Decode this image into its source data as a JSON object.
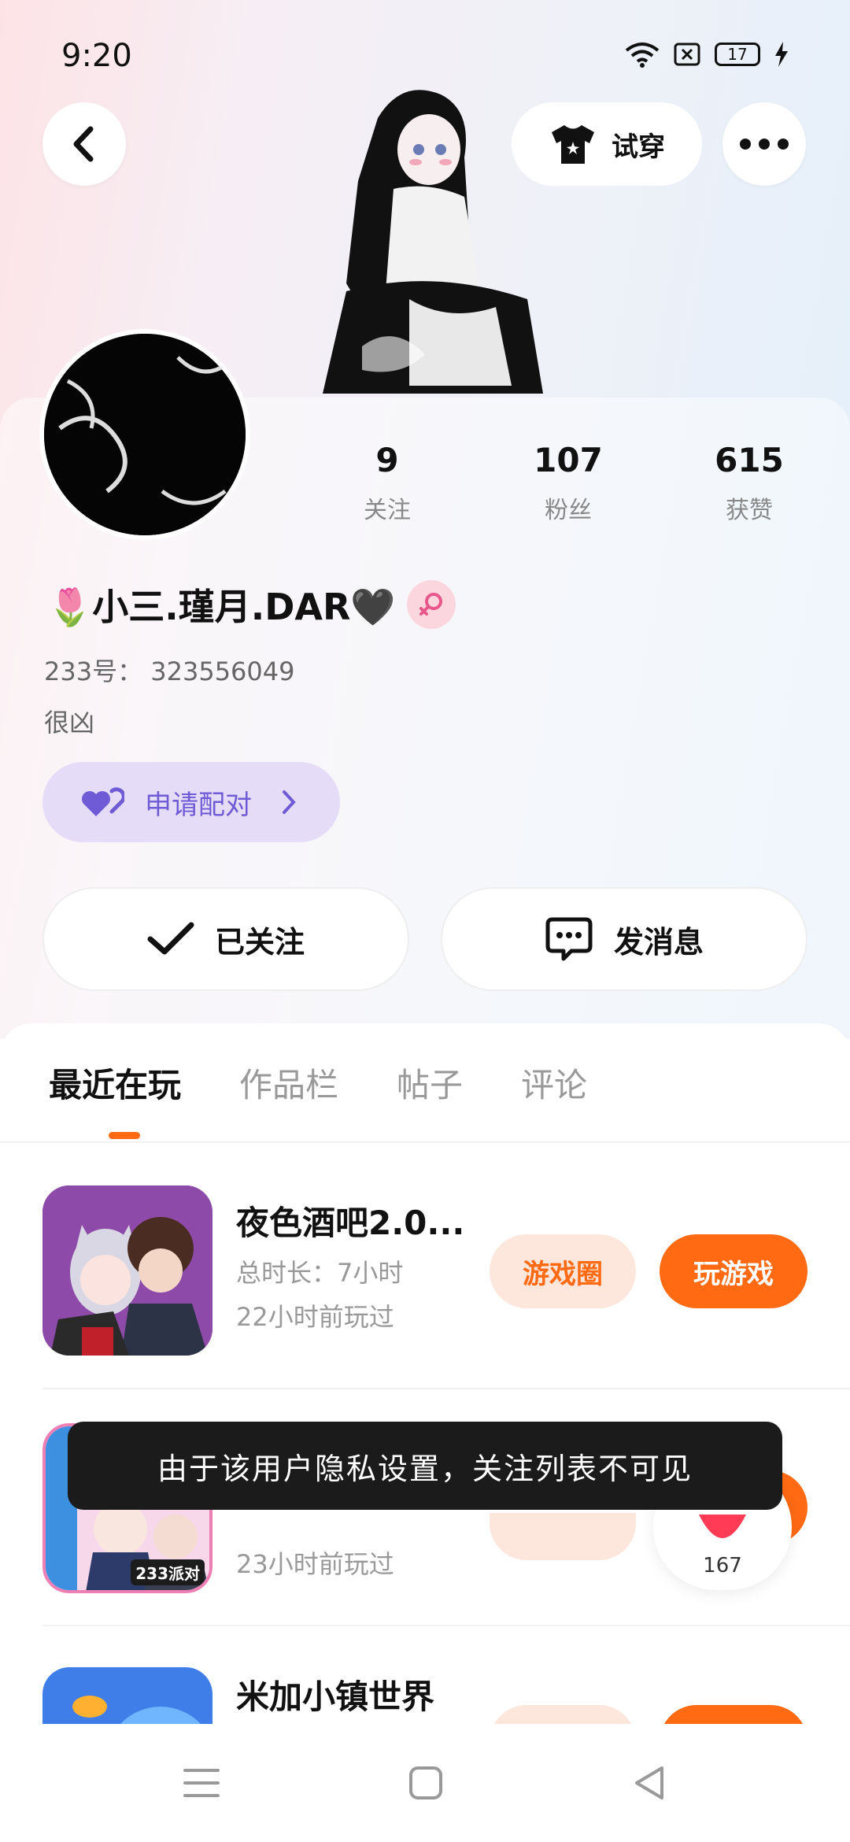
{
  "status_bar": {
    "time": "9:20",
    "battery": "17"
  },
  "header": {
    "back_icon": "chevron-left-icon",
    "tryon_label": "试穿",
    "more_icon": "more-dots-icon"
  },
  "profile": {
    "stats": [
      {
        "value": "9",
        "label": "关注"
      },
      {
        "value": "107",
        "label": "粉丝"
      },
      {
        "value": "615",
        "label": "获赞"
      }
    ],
    "nickname": "🌷小三.瑾月.DAR🖤",
    "uid": "233号： 323556049",
    "bio": "很凶",
    "pair_label": "申请配对",
    "followed_label": "已关注",
    "message_label": "发消息"
  },
  "tabs": [
    {
      "label": "最近在玩",
      "active": true
    },
    {
      "label": "作品栏",
      "active": false
    },
    {
      "label": "帖子",
      "active": false
    },
    {
      "label": "评论",
      "active": false
    }
  ],
  "games": [
    {
      "title": "夜色酒吧2.0...",
      "playtime": "总时长：7小时",
      "last_played": "22小时前玩过",
      "circle_label": "游戏圈",
      "play_label": "玩游戏"
    },
    {
      "title": "",
      "playtime": "",
      "last_played": "23小时前玩过",
      "circle_label": "",
      "play_label": "",
      "badge": "233派对"
    },
    {
      "title": "米加小镇世界",
      "playtime": "",
      "last_played": "",
      "circle_label": "",
      "play_label": ""
    }
  ],
  "toast": "由于该用户隐私设置，关注列表不可见",
  "like_count": "167",
  "colors": {
    "accent": "#ff6a13",
    "pair_bg": "#e5ddf7",
    "pair_fg": "#6f5bd6"
  }
}
